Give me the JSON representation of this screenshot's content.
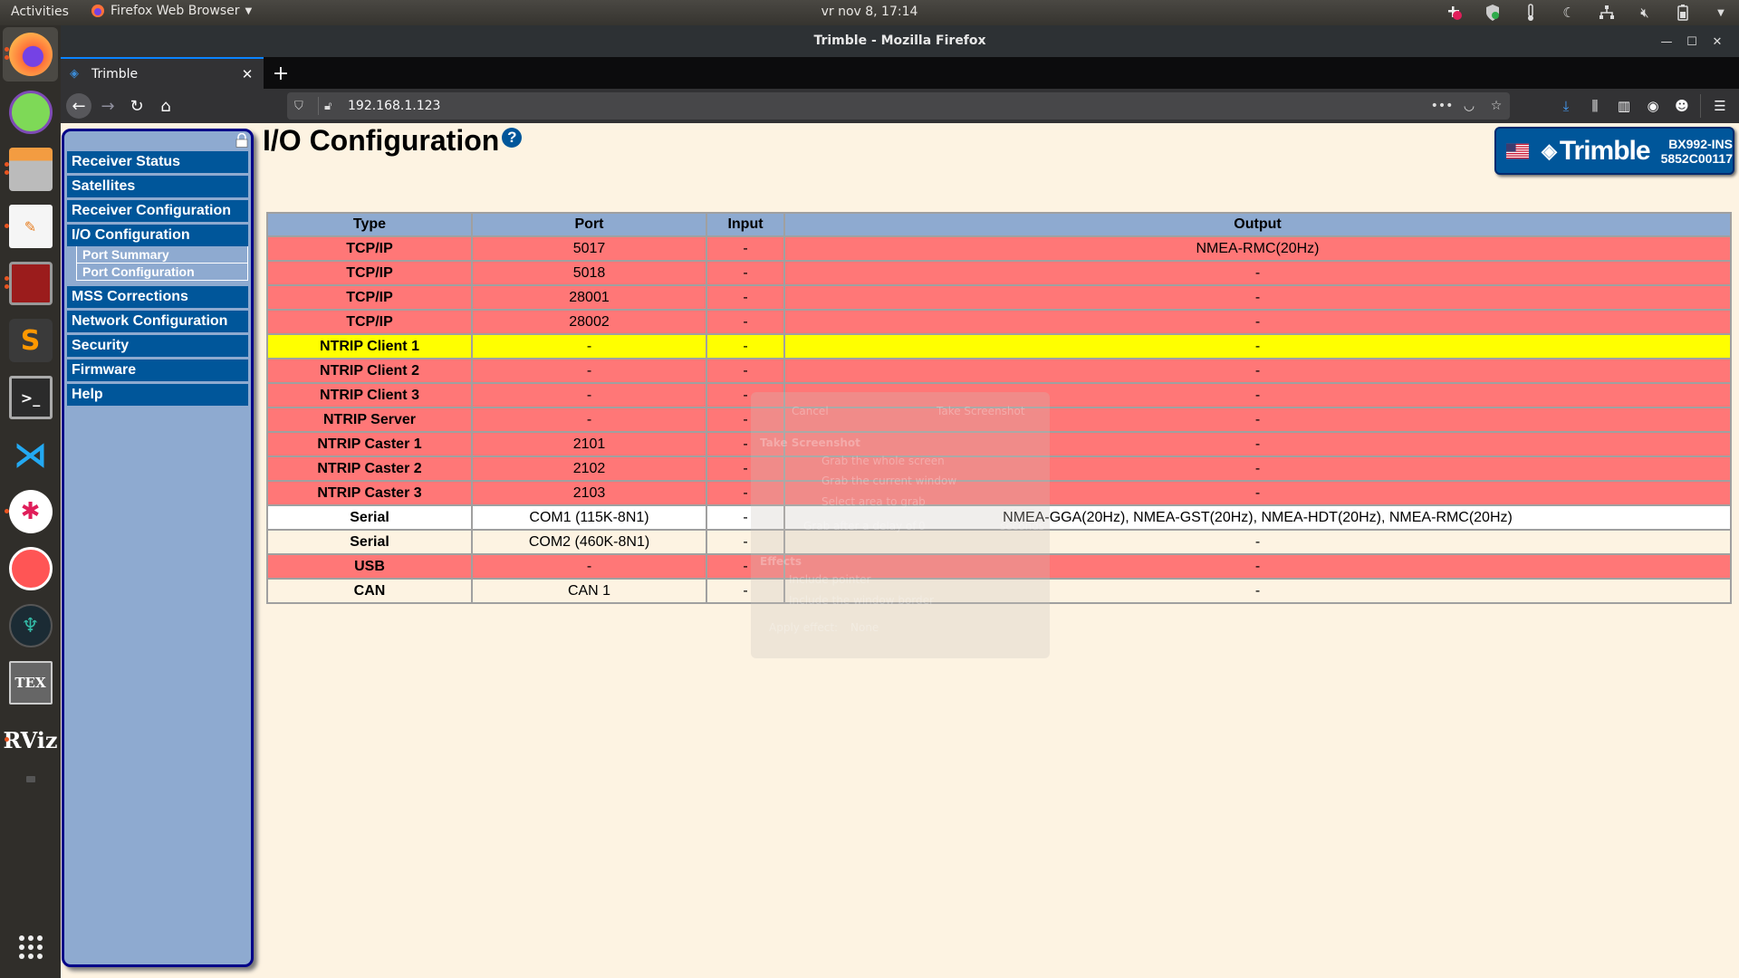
{
  "topbar": {
    "activities": "Activities",
    "app_name": "Firefox Web Browser",
    "clock": "vr nov  8, 17:14",
    "tray": [
      "slack-icon",
      "shield-check-icon",
      "thermometer-icon",
      "night-light-icon",
      "network-icon",
      "volume-muted-icon",
      "battery-icon",
      "system-menu-chevron-icon"
    ]
  },
  "dock": {
    "apps": [
      "Firefox",
      "Tor Browser",
      "Files",
      "Text Editor",
      "Terminator",
      "Sublime Text",
      "Terminal",
      "Visual Studio Code",
      "Slack",
      "Mind Map",
      "GitKraken",
      "TeXmaker",
      "RViz",
      "Screenshot"
    ],
    "show_apps_label": "Show Applications"
  },
  "window": {
    "title": "Trimble - Mozilla Firefox",
    "tab_title": "Trimble",
    "url": "192.168.1.123"
  },
  "page": {
    "heading": "I/O Configuration",
    "help_glyph": "?",
    "brand": {
      "logo_text": "Trimble",
      "model": "BX992-INS",
      "serial": "5852C00117"
    },
    "menu": [
      {
        "label": "Receiver Status"
      },
      {
        "label": "Satellites"
      },
      {
        "label": "Receiver Configuration"
      },
      {
        "label": "I/O Configuration",
        "submenu": [
          "Port Summary",
          "Port Configuration"
        ]
      },
      {
        "label": "MSS Corrections"
      },
      {
        "label": "Network Configuration"
      },
      {
        "label": "Security"
      },
      {
        "label": "Firmware"
      },
      {
        "label": "Help"
      }
    ],
    "row_colors": {
      "red": "#ff7777",
      "yellow": "#ffff00",
      "white": "#ffffff",
      "cream": "#fdf3e2"
    },
    "table": {
      "headers": [
        "Type",
        "Port",
        "Input",
        "Output"
      ],
      "rows": [
        {
          "type": "TCP/IP",
          "port": "5017",
          "input": "-",
          "output": "NMEA-RMC(20Hz)",
          "status": "red"
        },
        {
          "type": "TCP/IP",
          "port": "5018",
          "input": "-",
          "output": "-",
          "status": "red"
        },
        {
          "type": "TCP/IP",
          "port": "28001",
          "input": "-",
          "output": "-",
          "status": "red"
        },
        {
          "type": "TCP/IP",
          "port": "28002",
          "input": "-",
          "output": "-",
          "status": "red"
        },
        {
          "type": "NTRIP Client 1",
          "port": "-",
          "input": "-",
          "output": "-",
          "status": "yellow"
        },
        {
          "type": "NTRIP Client 2",
          "port": "-",
          "input": "-",
          "output": "-",
          "status": "red"
        },
        {
          "type": "NTRIP Client 3",
          "port": "-",
          "input": "-",
          "output": "-",
          "status": "red"
        },
        {
          "type": "NTRIP Server",
          "port": "-",
          "input": "-",
          "output": "-",
          "status": "red"
        },
        {
          "type": "NTRIP Caster 1",
          "port": "2101",
          "input": "-",
          "output": "-",
          "status": "red"
        },
        {
          "type": "NTRIP Caster 2",
          "port": "2102",
          "input": "-",
          "output": "-",
          "status": "red"
        },
        {
          "type": "NTRIP Caster 3",
          "port": "2103",
          "input": "-",
          "output": "-",
          "status": "red"
        },
        {
          "type": "Serial",
          "port": "COM1 (115K-8N1)",
          "input": "-",
          "output": "NMEA-GGA(20Hz), NMEA-GST(20Hz), NMEA-HDT(20Hz), NMEA-RMC(20Hz)",
          "status": "white"
        },
        {
          "type": "Serial",
          "port": "COM2 (460K-8N1)",
          "input": "-",
          "output": "-",
          "status": "cream"
        },
        {
          "type": "USB",
          "port": "-",
          "input": "-",
          "output": "-",
          "status": "red"
        },
        {
          "type": "CAN",
          "port": "CAN 1",
          "input": "-",
          "output": "-",
          "status": "cream"
        }
      ]
    }
  },
  "ghost_dialog": {
    "cancel": "Cancel",
    "take": "Take Screenshot",
    "heading": "Take Screenshot",
    "options": [
      "Grab the whole screen",
      "Grab the current window",
      "Select area to grab"
    ],
    "delay_label": "Grab after a delay of",
    "delay_value": "0",
    "delay_unit": "seconds",
    "effects": "Effects",
    "include_pointer": "Include pointer",
    "include_border": "Include the window border",
    "apply_effect": "Apply effect:",
    "effect_value": "None"
  }
}
